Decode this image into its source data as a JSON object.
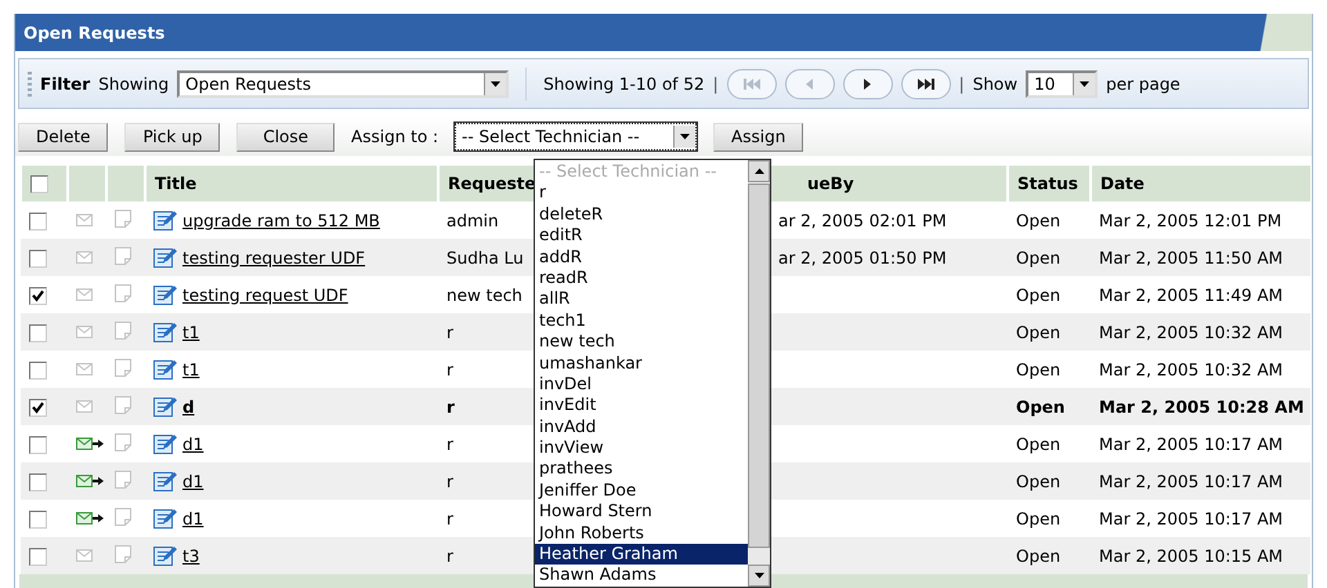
{
  "panel": {
    "title": "Open Requests"
  },
  "filter_bar": {
    "label": "Filter",
    "showing_label": "Showing",
    "view_select": {
      "value": "Open Requests"
    },
    "range": "Showing 1-10 of 52",
    "separator_1": "|",
    "pager": [
      {
        "kind": "first",
        "disabled": true
      },
      {
        "kind": "previous",
        "disabled": true
      },
      {
        "kind": "next",
        "disabled": false
      },
      {
        "kind": "last",
        "disabled": false
      }
    ],
    "separator_2": "|",
    "show_label": "Show",
    "page_size": {
      "value": "10"
    },
    "per_page_label": "per page"
  },
  "toolbar": {
    "buttons": [
      "Delete",
      "Pick up",
      "Close"
    ],
    "assign_label": "Assign to :",
    "technician_select": {
      "value": "-- Select Technician --",
      "expanded": true
    },
    "assign_button": "Assign"
  },
  "technician_list": {
    "items": [
      {
        "label": "-- Select Technician --",
        "kind": "placeholder",
        "selected": false
      },
      {
        "label": "r",
        "kind": "option",
        "selected": false
      },
      {
        "label": "deleteR",
        "kind": "option",
        "selected": false
      },
      {
        "label": "editR",
        "kind": "option",
        "selected": false
      },
      {
        "label": "addR",
        "kind": "option",
        "selected": false
      },
      {
        "label": "readR",
        "kind": "option",
        "selected": false
      },
      {
        "label": "allR",
        "kind": "option",
        "selected": false
      },
      {
        "label": "tech1",
        "kind": "option",
        "selected": false
      },
      {
        "label": "new tech",
        "kind": "option",
        "selected": false
      },
      {
        "label": "umashankar",
        "kind": "option",
        "selected": false
      },
      {
        "label": "invDel",
        "kind": "option",
        "selected": false
      },
      {
        "label": "invEdit",
        "kind": "option",
        "selected": false
      },
      {
        "label": "invAdd",
        "kind": "option",
        "selected": false
      },
      {
        "label": "invView",
        "kind": "option",
        "selected": false
      },
      {
        "label": "prathees",
        "kind": "option",
        "selected": false
      },
      {
        "label": "Jeniffer Doe",
        "kind": "option",
        "selected": false
      },
      {
        "label": "Howard Stern",
        "kind": "option",
        "selected": false
      },
      {
        "label": "John Roberts",
        "kind": "option",
        "selected": false
      },
      {
        "label": "Heather Graham",
        "kind": "option",
        "selected": true
      },
      {
        "label": "Shawn Adams",
        "kind": "option",
        "selected": false
      }
    ]
  },
  "table": {
    "select_all_checked": false,
    "columns": [
      "Title",
      "Requeste",
      "ueBy",
      "Status",
      "Date"
    ],
    "rows": [
      {
        "checked": false,
        "mail_forwarded": false,
        "title": "upgrade ram to 512 MB",
        "requester": "admin",
        "due_by": "ar 2, 2005 02:01 PM",
        "status": "Open",
        "date": "Mar 2, 2005 12:01 PM",
        "unread": false
      },
      {
        "checked": false,
        "mail_forwarded": false,
        "title": "testing requester UDF",
        "requester": "Sudha Lu",
        "due_by": "ar 2, 2005 01:50 PM",
        "status": "Open",
        "date": "Mar 2, 2005 11:50 AM",
        "unread": false
      },
      {
        "checked": true,
        "mail_forwarded": false,
        "title": "testing request UDF",
        "requester": "new tech",
        "status": "Open",
        "date": "Mar 2, 2005 11:49 AM",
        "unread": false
      },
      {
        "checked": false,
        "mail_forwarded": false,
        "title": "t1",
        "requester": "r",
        "status": "Open",
        "date": "Mar 2, 2005 10:32 AM",
        "unread": false
      },
      {
        "checked": false,
        "mail_forwarded": false,
        "title": "t1",
        "requester": "r",
        "status": "Open",
        "date": "Mar 2, 2005 10:32 AM",
        "unread": false
      },
      {
        "checked": true,
        "mail_forwarded": false,
        "title": "d",
        "requester": "r",
        "status": "Open",
        "date": "Mar 2, 2005 10:28 AM",
        "unread": true
      },
      {
        "checked": false,
        "mail_forwarded": true,
        "title": "d1",
        "requester": "r",
        "status": "Open",
        "date": "Mar 2, 2005 10:17 AM",
        "unread": false
      },
      {
        "checked": false,
        "mail_forwarded": true,
        "title": "d1",
        "requester": "r",
        "status": "Open",
        "date": "Mar 2, 2005 10:17 AM",
        "unread": false
      },
      {
        "checked": false,
        "mail_forwarded": true,
        "title": "d1",
        "requester": "r",
        "status": "Open",
        "date": "Mar 2, 2005 10:17 AM",
        "unread": false
      },
      {
        "checked": false,
        "mail_forwarded": false,
        "title": "t3",
        "requester": "r",
        "status": "Open",
        "date": "Mar 2, 2005 10:15 AM",
        "unread": false
      }
    ]
  }
}
